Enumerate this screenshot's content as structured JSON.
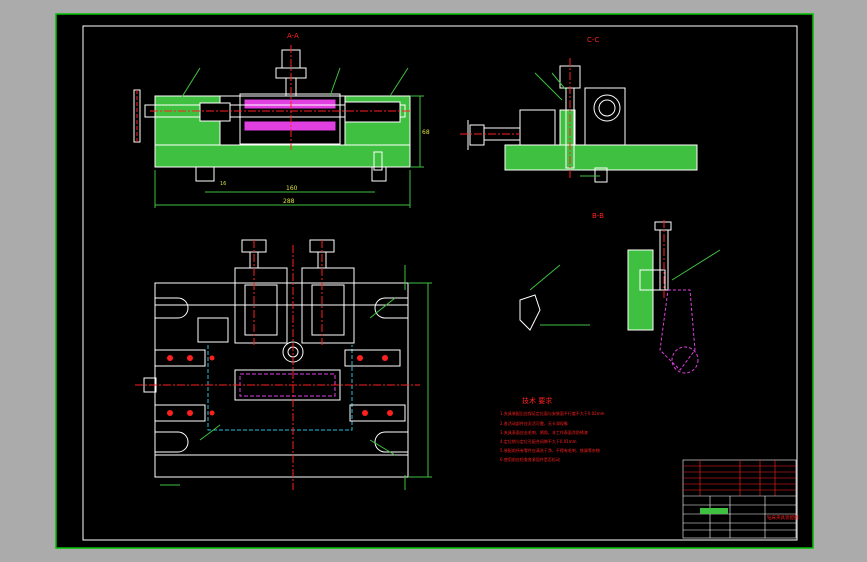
{
  "colors": {
    "viewport_bg": "#ababab",
    "sheet_bg": "#000000",
    "sheet_outer_border": "#00c000",
    "drawing": "#ffffff",
    "green": "#40c040",
    "red": "#ff2020",
    "magenta": "#e040e0",
    "cyan": "#20c0e0",
    "yellow": "#e0e040"
  },
  "views": {
    "section_aa_label": "A-A",
    "section_cc_label": "C-C",
    "section_bb_label": "B-B"
  },
  "dimensions": {
    "aa_overall_width": "288",
    "aa_inner_width": "160",
    "aa_height": "68",
    "aa_small": "16"
  },
  "notes": {
    "heading": "技术 要求",
    "lines": [
      "1.夹具装配后应保证定位面与安装面平行度不大于0.02mm",
      "2.各活动部件应灵活可靠，无卡滞现象",
      "3.夹具表面应去毛刺、倒角，非工作表面涂防锈漆",
      "4.定位销与定位孔配合间隙不大于0.01mm",
      "5.装配前所有零件应清洗干净，不得有毛刺、铁屑等杂物",
      "6.使用前应检查各紧固件是否松动"
    ]
  },
  "title_block": {
    "drawing_title": "钻床夹具装配图"
  }
}
